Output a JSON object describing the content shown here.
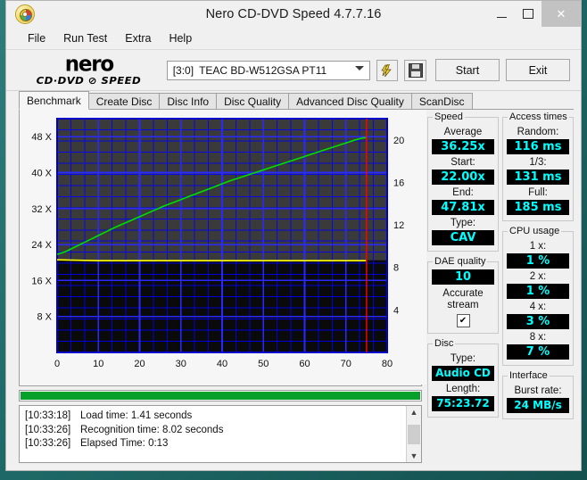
{
  "window": {
    "title": "Nero CD-DVD Speed 4.7.7.16",
    "icon": "nero-disc-icon",
    "minimize": "minimize-icon",
    "maximize": "maximize-icon",
    "close": "✕"
  },
  "menu": {
    "items": [
      "File",
      "Run Test",
      "Extra",
      "Help"
    ]
  },
  "toolbar": {
    "logo_main": "nero",
    "logo_sub": "CD·DVD ⊘ SPEED",
    "drive_id": "[3:0]",
    "drive_name": "TEAC BD-W512GSA PT11",
    "speed_icon": "lightning-bolt-icon",
    "save_icon": "floppy-disk-icon",
    "start_label": "Start",
    "exit_label": "Exit"
  },
  "tabs": [
    {
      "label": "Benchmark",
      "active": true
    },
    {
      "label": "Create Disc",
      "active": false
    },
    {
      "label": "Disc Info",
      "active": false
    },
    {
      "label": "Disc Quality",
      "active": false
    },
    {
      "label": "Advanced Disc Quality",
      "active": false
    },
    {
      "label": "ScanDisc",
      "active": false
    }
  ],
  "chart_data": {
    "type": "line",
    "title": "",
    "xlabel": "",
    "ylabel": "",
    "x_ticks": [
      0,
      10,
      20,
      30,
      40,
      50,
      60,
      70,
      80
    ],
    "xlim": [
      0,
      80
    ],
    "y_left_ticks": [
      "8 X",
      "16 X",
      "24 X",
      "32 X",
      "40 X",
      "48 X"
    ],
    "y_left_values": [
      8,
      16,
      24,
      32,
      40,
      48
    ],
    "ylim_left": [
      0,
      52
    ],
    "y_right_ticks": [
      4,
      8,
      12,
      16,
      20
    ],
    "ylim_right": [
      0,
      22
    ],
    "grid": true,
    "bg_color": "#3a3a3a",
    "bg_color_lower": "#0a0a0a",
    "grid_color": "#0000ff",
    "series": [
      {
        "name": "read-speed",
        "color": "#00e000",
        "x": [
          0,
          2,
          4,
          6,
          8,
          10,
          12,
          14,
          16,
          18,
          20,
          22,
          24,
          26,
          28,
          30,
          32,
          34,
          36,
          38,
          40,
          42,
          44,
          46,
          48,
          50,
          52,
          54,
          56,
          58,
          60,
          62,
          64,
          66,
          68,
          70,
          72,
          74,
          75
        ],
        "values": [
          21.8,
          22.4,
          23.3,
          24.2,
          25.1,
          26.0,
          26.9,
          27.8,
          28.6,
          29.4,
          30.2,
          31.0,
          31.8,
          32.6,
          33.3,
          34.0,
          34.7,
          35.4,
          36.1,
          36.8,
          37.5,
          38.2,
          38.8,
          39.4,
          40.0,
          40.6,
          41.2,
          41.8,
          42.4,
          43.0,
          43.6,
          44.2,
          44.8,
          45.4,
          46.0,
          46.6,
          47.2,
          47.7,
          47.81
        ]
      },
      {
        "name": "cpu-usage-or-transfer",
        "color": "#ffff00",
        "x": [
          0,
          10,
          20,
          30,
          40,
          50,
          60,
          70,
          75
        ],
        "values": [
          20.6,
          20.4,
          20.4,
          20.4,
          20.4,
          20.4,
          20.4,
          20.4,
          20.4
        ]
      }
    ],
    "marker_line": {
      "name": "disc-end-marker",
      "x": 75,
      "color": "#ff0000"
    }
  },
  "progress": {
    "percent": 100,
    "color": "#06a02a"
  },
  "log": {
    "lines": [
      {
        "time": "[10:33:18]",
        "text": "Load time: 1.41 seconds"
      },
      {
        "time": "[10:33:26]",
        "text": "Recognition time: 8.02 seconds"
      },
      {
        "time": "[10:33:26]",
        "text": "Elapsed Time:  0:13"
      }
    ],
    "scroll_up": "▲",
    "scroll_down": "▼"
  },
  "stats": {
    "speed": {
      "legend": "Speed",
      "average_label": "Average",
      "average_value": "36.25x",
      "start_label": "Start:",
      "start_value": "22.00x",
      "end_label": "End:",
      "end_value": "47.81x",
      "type_label": "Type:",
      "type_value": "CAV"
    },
    "dae": {
      "legend": "DAE quality",
      "value": "10",
      "accurate_line1": "Accurate",
      "accurate_line2": "stream",
      "checked": "✔"
    },
    "disc": {
      "legend": "Disc",
      "type_label": "Type:",
      "type_value": "Audio CD",
      "length_label": "Length:",
      "length_value": "75:23.72"
    },
    "access": {
      "legend": "Access times",
      "random_label": "Random:",
      "random_value": "116 ms",
      "third_label": "1/3:",
      "third_value": "131 ms",
      "full_label": "Full:",
      "full_value": "185 ms"
    },
    "cpu": {
      "legend": "CPU usage",
      "x1_label": "1 x:",
      "x1_value": "1 %",
      "x2_label": "2 x:",
      "x2_value": "1 %",
      "x4_label": "4 x:",
      "x4_value": "3 %",
      "x8_label": "8 x:",
      "x8_value": "7 %"
    },
    "interface": {
      "legend": "Interface",
      "burst_label": "Burst rate:",
      "burst_value": "24 MB/s"
    }
  }
}
